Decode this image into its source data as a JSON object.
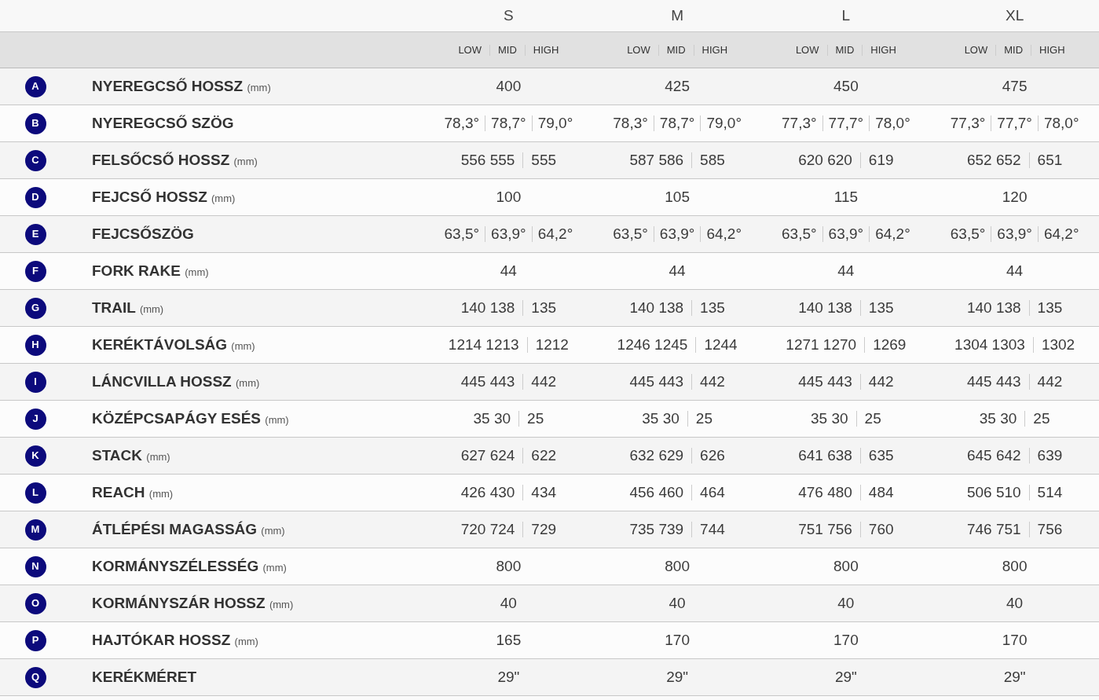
{
  "sizes": [
    "S",
    "M",
    "L",
    "XL"
  ],
  "positions": [
    [
      "LOW",
      "MID",
      "HIGH"
    ],
    [
      "LOW",
      "MID",
      "HIGH"
    ],
    [
      "LOW",
      "MID",
      "HIGH"
    ],
    [
      "LOW",
      "MID",
      "HIGH"
    ]
  ],
  "rows": [
    {
      "letter": "A",
      "name": "NYEREGCSŐ HOSSZ",
      "unit": "(mm)",
      "values": [
        [
          "400"
        ],
        [
          "425"
        ],
        [
          "450"
        ],
        [
          "475"
        ]
      ]
    },
    {
      "letter": "B",
      "name": "NYEREGCSŐ SZÖG",
      "values": [
        [
          "78,3°",
          "78,7°",
          "79,0°"
        ],
        [
          "78,3°",
          "78,7°",
          "79,0°"
        ],
        [
          "77,3°",
          "77,7°",
          "78,0°"
        ],
        [
          "77,3°",
          "77,7°",
          "78,0°"
        ]
      ]
    },
    {
      "letter": "C",
      "name": "FELSŐCSŐ HOSSZ",
      "unit": "(mm)",
      "values": [
        [
          "556 555",
          "555"
        ],
        [
          "587 586",
          "585"
        ],
        [
          "620 620",
          "619"
        ],
        [
          "652 652",
          "651"
        ]
      ]
    },
    {
      "letter": "D",
      "name": "FEJCSŐ HOSSZ",
      "unit": "(mm)",
      "values": [
        [
          "100"
        ],
        [
          "105"
        ],
        [
          "115"
        ],
        [
          "120"
        ]
      ]
    },
    {
      "letter": "E",
      "name": "FEJCSŐSZÖG",
      "values": [
        [
          "63,5°",
          "63,9°",
          "64,2°"
        ],
        [
          "63,5°",
          "63,9°",
          "64,2°"
        ],
        [
          "63,5°",
          "63,9°",
          "64,2°"
        ],
        [
          "63,5°",
          "63,9°",
          "64,2°"
        ]
      ]
    },
    {
      "letter": "F",
      "name": "FORK RAKE",
      "unit": "(mm)",
      "values": [
        [
          "44"
        ],
        [
          "44"
        ],
        [
          "44"
        ],
        [
          "44"
        ]
      ]
    },
    {
      "letter": "G",
      "name": "TRAIL",
      "unit": "(mm)",
      "values": [
        [
          "140 138",
          "135"
        ],
        [
          "140 138",
          "135"
        ],
        [
          "140 138",
          "135"
        ],
        [
          "140 138",
          "135"
        ]
      ]
    },
    {
      "letter": "H",
      "name": "KERÉKTÁVOLSÁG",
      "unit": "(mm)",
      "values": [
        [
          "1214 1213",
          "1212"
        ],
        [
          "1246 1245",
          "1244"
        ],
        [
          "1271 1270",
          "1269"
        ],
        [
          "1304 1303",
          "1302"
        ]
      ]
    },
    {
      "letter": "I",
      "name": "LÁNCVILLA HOSSZ",
      "unit": "(mm)",
      "values": [
        [
          "445 443",
          "442"
        ],
        [
          "445 443",
          "442"
        ],
        [
          "445 443",
          "442"
        ],
        [
          "445 443",
          "442"
        ]
      ]
    },
    {
      "letter": "J",
      "name": "KÖZÉPCSAPÁGY ESÉS",
      "unit": "(mm)",
      "values": [
        [
          "35 30",
          "25"
        ],
        [
          "35 30",
          "25"
        ],
        [
          "35 30",
          "25"
        ],
        [
          "35 30",
          "25"
        ]
      ]
    },
    {
      "letter": "K",
      "name": "STACK",
      "unit": "(mm)",
      "values": [
        [
          "627 624",
          "622"
        ],
        [
          "632 629",
          "626"
        ],
        [
          "641 638",
          "635"
        ],
        [
          "645 642",
          "639"
        ]
      ]
    },
    {
      "letter": "L",
      "name": "REACH",
      "unit": "(mm)",
      "values": [
        [
          "426 430",
          "434"
        ],
        [
          "456 460",
          "464"
        ],
        [
          "476 480",
          "484"
        ],
        [
          "506 510",
          "514"
        ]
      ]
    },
    {
      "letter": "M",
      "name": "ÁTLÉPÉSI MAGASSÁG",
      "unit": "(mm)",
      "values": [
        [
          "720 724",
          "729"
        ],
        [
          "735 739",
          "744"
        ],
        [
          "751 756",
          "760"
        ],
        [
          "746 751",
          "756"
        ]
      ]
    },
    {
      "letter": "N",
      "name": "KORMÁNYSZÉLESSÉG",
      "unit": "(mm)",
      "values": [
        [
          "800"
        ],
        [
          "800"
        ],
        [
          "800"
        ],
        [
          "800"
        ]
      ]
    },
    {
      "letter": "O",
      "name": "KORMÁNYSZÁR HOSSZ",
      "unit": "(mm)",
      "values": [
        [
          "40"
        ],
        [
          "40"
        ],
        [
          "40"
        ],
        [
          "40"
        ]
      ]
    },
    {
      "letter": "P",
      "name": "HAJTÓKAR HOSSZ",
      "unit": "(mm)",
      "values": [
        [
          "165"
        ],
        [
          "170"
        ],
        [
          "170"
        ],
        [
          "170"
        ]
      ]
    },
    {
      "letter": "Q",
      "name": "KERÉKMÉRET",
      "values": [
        [
          "29\""
        ],
        [
          "29\""
        ],
        [
          "29\""
        ],
        [
          "29\""
        ]
      ]
    }
  ]
}
